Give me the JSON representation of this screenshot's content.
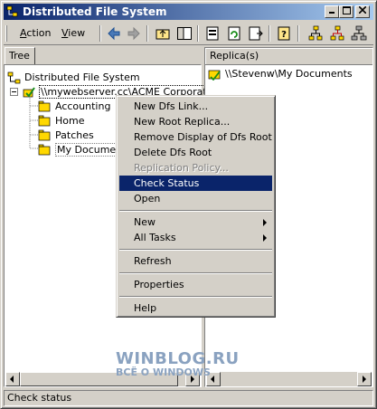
{
  "window": {
    "title": "Distributed File System"
  },
  "menu": {
    "action": "Action",
    "action_u": "A",
    "view": "View",
    "view_u": "V"
  },
  "tree": {
    "tab_label": "Tree",
    "root": "Distributed File System",
    "server": "\\\\mywebserver.cc\\ACME Corporation",
    "children": [
      "Accounting",
      "Home",
      "Patches",
      "My Documents"
    ]
  },
  "replica": {
    "header": "Replica(s)",
    "items": [
      "\\\\Stevenw\\My Documents"
    ]
  },
  "context_menu": {
    "items": [
      "New Dfs Link...",
      "New Root Replica...",
      "Remove Display of Dfs Root",
      "Delete Dfs Root",
      "Replication Policy...",
      "Check Status",
      "Open",
      "New",
      "All Tasks",
      "Refresh",
      "Properties",
      "Help"
    ],
    "selected": "Check Status",
    "disabled": "Replication Policy..."
  },
  "watermark": {
    "line1": "WINBLOG.RU",
    "line2": "ВСЁ О WINDOWS"
  },
  "status": {
    "text": "Check status"
  },
  "colors": {
    "title_start": "#0a246a",
    "title_end": "#a6caf0",
    "selection": "#0a246a",
    "face": "#d4d0c8"
  }
}
